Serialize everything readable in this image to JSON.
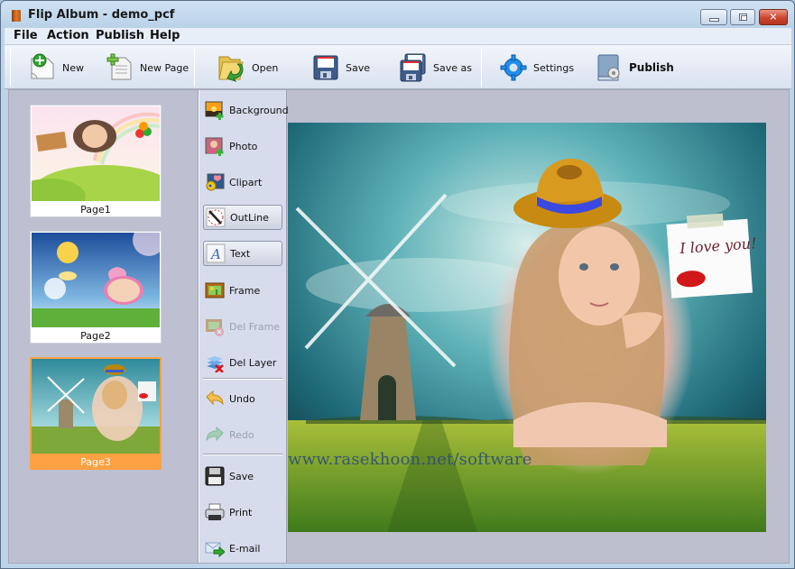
{
  "window": {
    "title": "Flip Album - demo_pcf",
    "controls": {
      "minimize": "minimize",
      "maximize": "maximize",
      "close": "✕"
    }
  },
  "menu": [
    "File",
    "Action",
    "Publish",
    "Help"
  ],
  "toolbar": {
    "new": "New",
    "new_page": "New Page",
    "open": "Open",
    "save": "Save",
    "save_as": "Save as",
    "settings": "Settings",
    "publish": "Publish"
  },
  "pages": [
    {
      "label": "Page1",
      "selected": false
    },
    {
      "label": "Page2",
      "selected": false
    },
    {
      "label": "Page3",
      "selected": true
    }
  ],
  "tools": {
    "background": "Background",
    "photo": "Photo",
    "clipart": "Clipart",
    "outline": "OutLine",
    "text": "Text",
    "frame": "Frame",
    "del_frame": "Del Frame",
    "del_layer": "Del Layer",
    "undo": "Undo",
    "redo": "Redo",
    "save": "Save",
    "print": "Print",
    "email": "E-mail"
  },
  "canvas": {
    "watermark": "www.rasekhoon.net/software",
    "note_text": "I love you!"
  },
  "colors": {
    "selected_page": "#fda142",
    "close_button": "#c9452f",
    "panel_bg": "#bdbfcf"
  }
}
